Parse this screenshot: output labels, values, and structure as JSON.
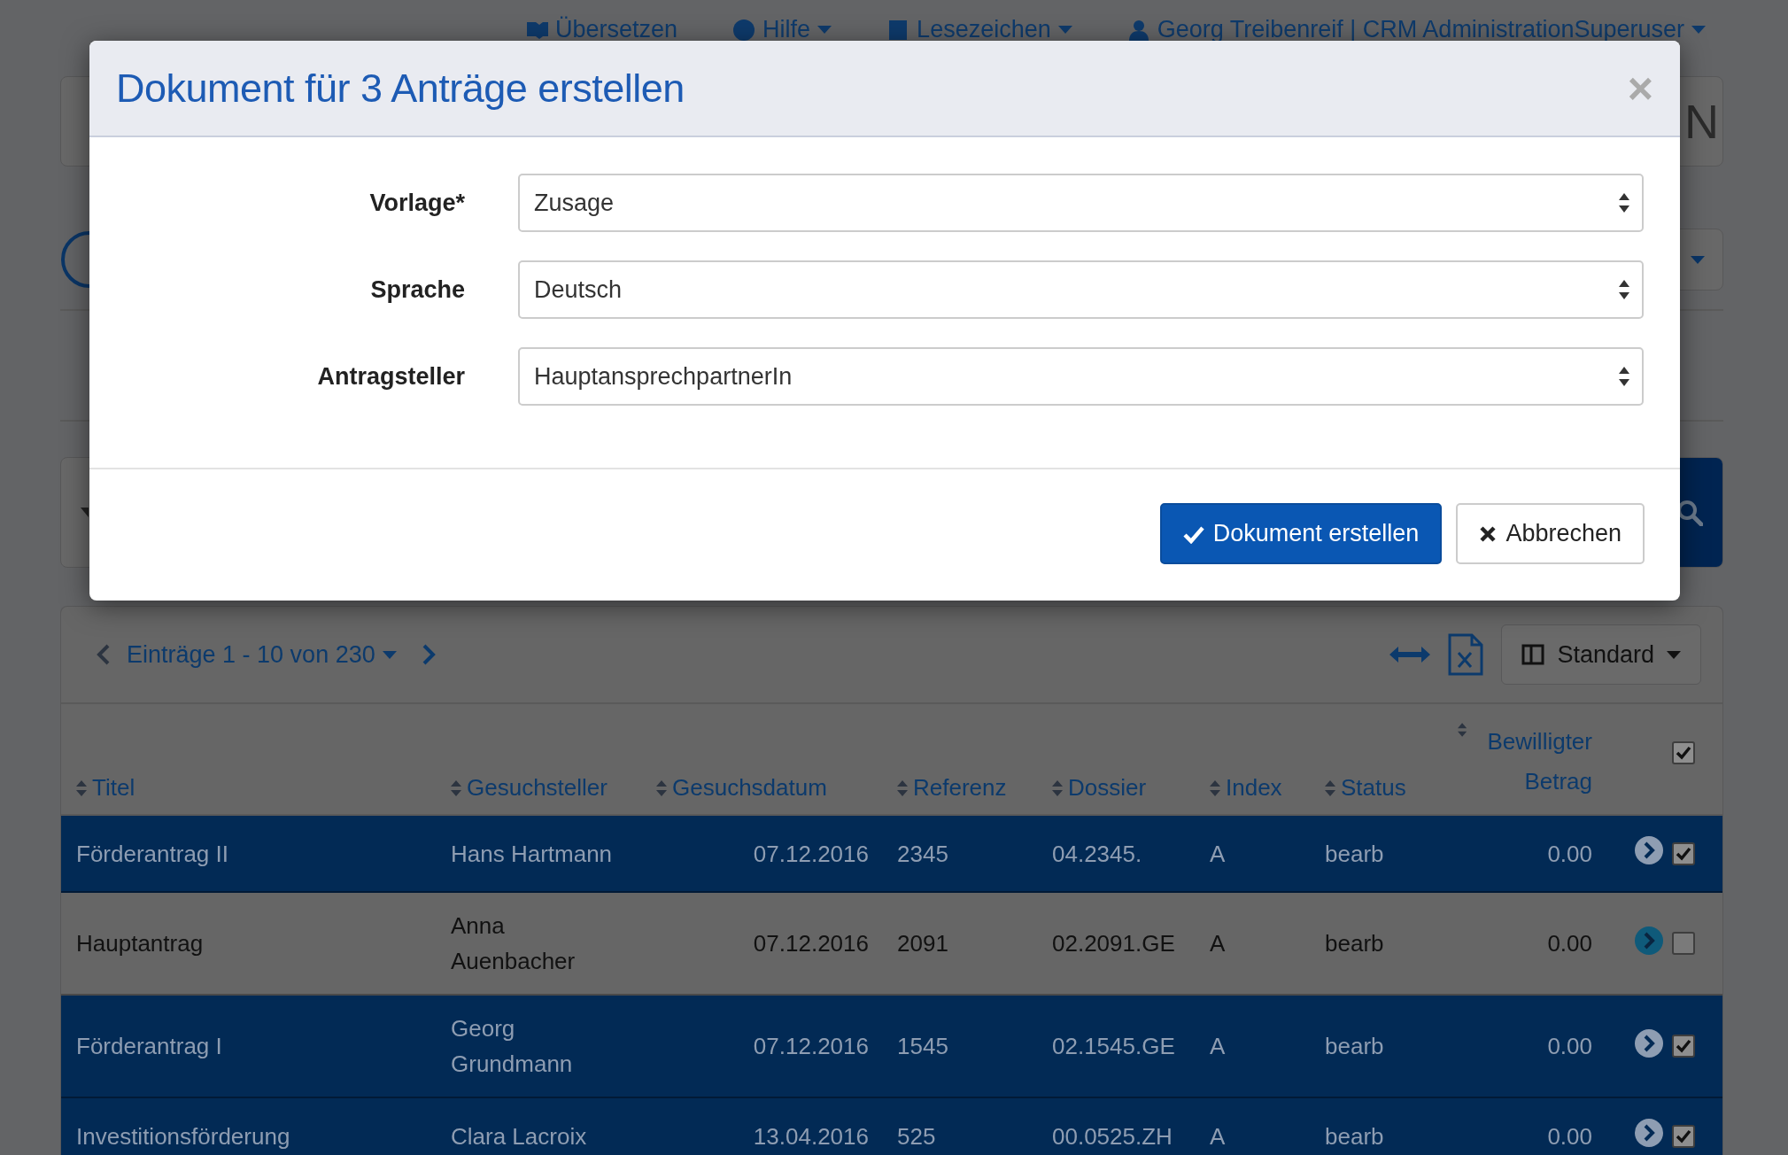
{
  "nav": [
    {
      "kind": "translate",
      "label": "Übersetzen",
      "caret": false
    },
    {
      "kind": "help",
      "label": "Hilfe",
      "caret": true
    },
    {
      "kind": "bookmark",
      "label": "Lesezeichen",
      "caret": true
    },
    {
      "kind": "user",
      "label": "Georg Treibenreif | CRM AdministrationSuperuser",
      "caret": true
    }
  ],
  "header_fragment": "N",
  "toolbar": {
    "pager": "Einträge 1 - 10 von 230",
    "view": "Standard"
  },
  "table": {
    "columns": [
      "Titel",
      "Gesuchsteller",
      "Gesuchsdatum",
      "Referenz",
      "Dossier",
      "Index",
      "Status",
      "Bewilligter Betrag"
    ],
    "header_checked": true,
    "rows": [
      {
        "title": "Förderantrag II",
        "applicant": "Hans Hartmann",
        "date": "07.12.2016",
        "reference": "2345",
        "dossier": "04.2345.",
        "index": "A",
        "status": "bearb",
        "amount": "0.00",
        "selected": true,
        "checked": true
      },
      {
        "title": "Hauptantrag",
        "applicant": "Anna Auenbacher",
        "date": "07.12.2016",
        "reference": "2091",
        "dossier": "02.2091.GE",
        "index": "A",
        "status": "bearb",
        "amount": "0.00",
        "selected": false,
        "checked": false
      },
      {
        "title": "Förderantrag I",
        "applicant": "Georg Grundmann",
        "date": "07.12.2016",
        "reference": "1545",
        "dossier": "02.1545.GE",
        "index": "A",
        "status": "bearb",
        "amount": "0.00",
        "selected": true,
        "checked": true
      },
      {
        "title": "Investitionsförderung",
        "applicant": "Clara Lacroix",
        "date": "13.04.2016",
        "reference": "525",
        "dossier": "00.0525.ZH",
        "index": "A",
        "status": "bearb",
        "amount": "0.00",
        "selected": true,
        "checked": true
      }
    ]
  },
  "modal": {
    "title": "Dokument für 3 Anträge erstellen",
    "close": "×",
    "fields": [
      {
        "label": "Vorlage*",
        "value": "Zusage"
      },
      {
        "label": "Sprache",
        "value": "Deutsch"
      },
      {
        "label": "Antragsteller",
        "value": "HauptansprechpartnerIn"
      }
    ],
    "buttons": [
      {
        "kind": "primary",
        "label": "Dokument erstellen"
      },
      {
        "kind": "default",
        "label": "Abbrechen"
      }
    ]
  }
}
